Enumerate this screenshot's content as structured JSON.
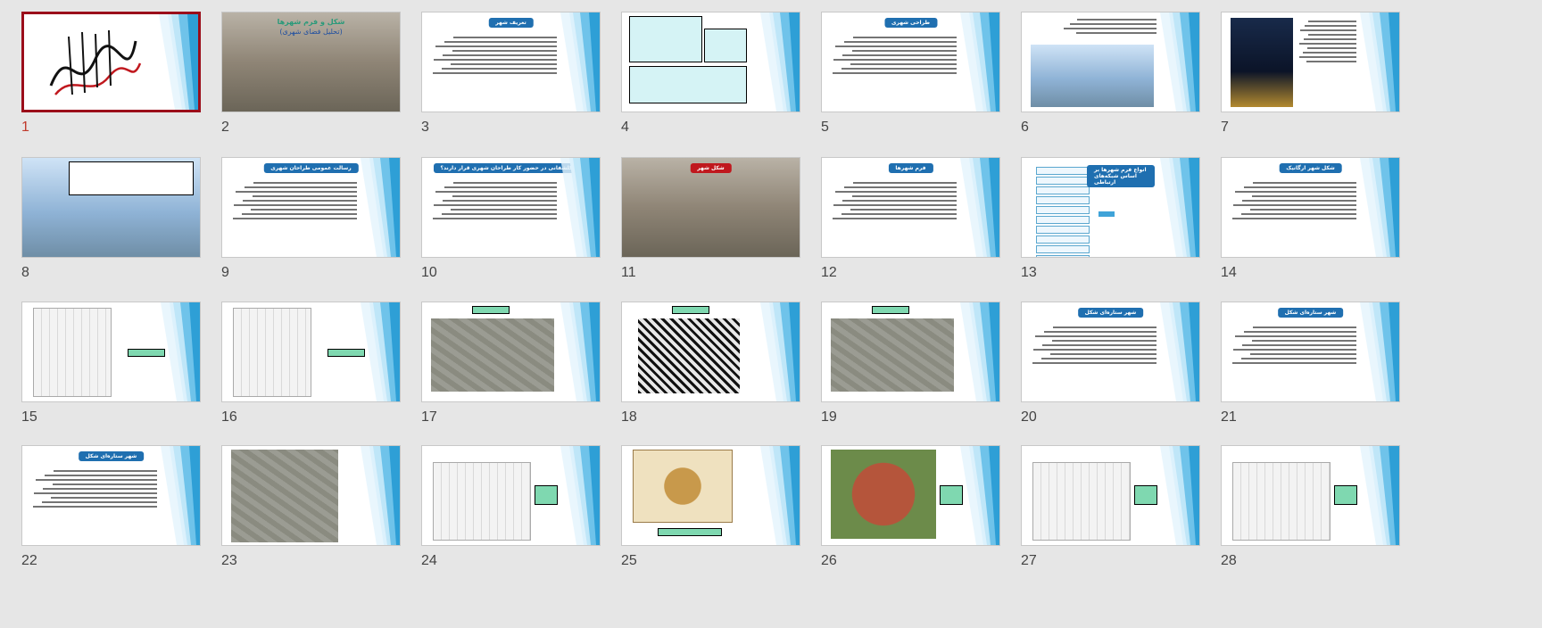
{
  "slides": [
    {
      "number": "1",
      "kind": "calligraphy",
      "selected": true
    },
    {
      "number": "2",
      "kind": "aerial-title",
      "title_line1": "شکل و فرم شهرها",
      "title_line2": "(تحلیل فضای شهری)"
    },
    {
      "number": "3",
      "kind": "text",
      "title": "تعریف شهر"
    },
    {
      "number": "4",
      "kind": "boxes"
    },
    {
      "number": "5",
      "kind": "text",
      "title": "طراحی شهری"
    },
    {
      "number": "6",
      "kind": "photo-text"
    },
    {
      "number": "7",
      "kind": "night-text"
    },
    {
      "number": "8",
      "kind": "sky-photo"
    },
    {
      "number": "9",
      "kind": "text",
      "title": "رسالت عمومی طراحان شهری"
    },
    {
      "number": "10",
      "kind": "text",
      "title": "چه کلشفانی در حضور کار طراحان شهری قرار دارند؟"
    },
    {
      "number": "11",
      "kind": "city-red",
      "title": "شکل شهر"
    },
    {
      "number": "12",
      "kind": "text",
      "title": "فرم شهرها"
    },
    {
      "number": "13",
      "kind": "list",
      "title": "انواع فرم شهرها بر اساس شبکه‌های ارتباطی"
    },
    {
      "number": "14",
      "kind": "text",
      "title": "شکل شهر ارگانیک"
    },
    {
      "number": "15",
      "kind": "map-label"
    },
    {
      "number": "16",
      "kind": "map-label"
    },
    {
      "number": "17",
      "kind": "aerial-center"
    },
    {
      "number": "18",
      "kind": "bw-center"
    },
    {
      "number": "19",
      "kind": "aerial-center"
    },
    {
      "number": "20",
      "kind": "text",
      "title": "شهر ستاره‌ای شکل"
    },
    {
      "number": "21",
      "kind": "text",
      "title": "شهر ستاره‌ای شکل"
    },
    {
      "number": "22",
      "kind": "text",
      "title": "شهر ستاره‌ای شکل"
    },
    {
      "number": "23",
      "kind": "aerial-big"
    },
    {
      "number": "24",
      "kind": "map-side"
    },
    {
      "number": "25",
      "kind": "oldmap"
    },
    {
      "number": "26",
      "kind": "redcity"
    },
    {
      "number": "27",
      "kind": "map-side"
    },
    {
      "number": "28",
      "kind": "map-side"
    }
  ],
  "colors": {
    "blue_art": "#2e9fd6",
    "selected_border": "#9b0d1a",
    "title_blue": "#1f6fb0"
  }
}
